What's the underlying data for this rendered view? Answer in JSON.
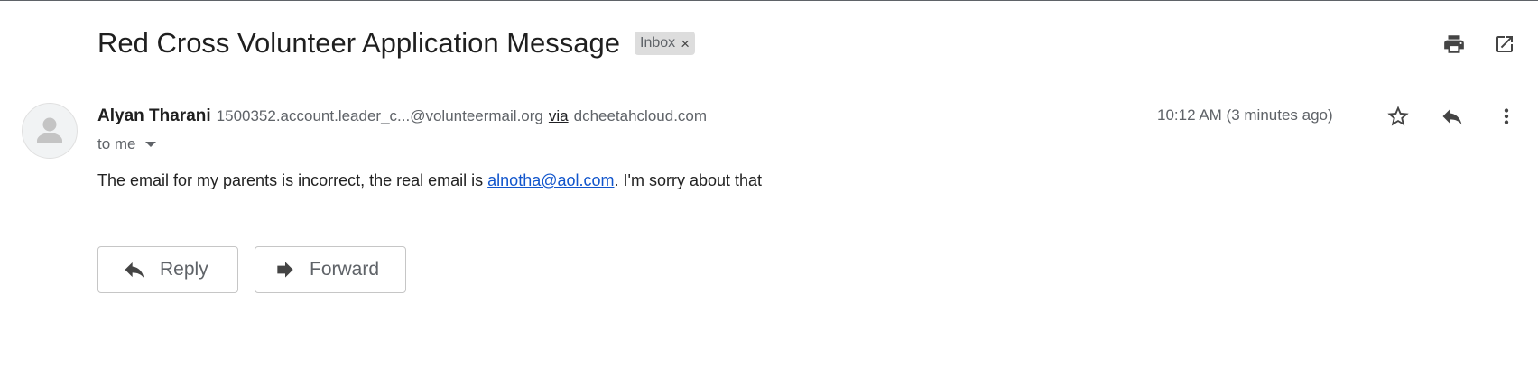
{
  "header": {
    "subject": "Red Cross Volunteer Application Message",
    "label": "Inbox",
    "label_remove_glyph": "×",
    "icons": [
      "print-icon",
      "open-in-new-window-icon"
    ]
  },
  "message": {
    "sender_name": "Alyan Tharani",
    "sender_email": "1500352.account.leader_c...@volunteermail.org",
    "via_text": "via",
    "via_domain": "dcheetahcloud.com",
    "recipient": "to me",
    "time": "10:12 AM (3 minutes ago)",
    "icons": [
      "star-icon",
      "reply-icon",
      "more-vert-icon"
    ],
    "body_before_link": "The email for my parents is incorrect, the real email is ",
    "body_link": "alnotha@aol.com",
    "body_after_link": ". I'm sorry about that"
  },
  "actions": {
    "reply_label": "Reply",
    "forward_label": "Forward"
  },
  "colors": {
    "link": "#1155cc",
    "chip_bg": "#dddddd",
    "muted_text": "#5f6368"
  }
}
